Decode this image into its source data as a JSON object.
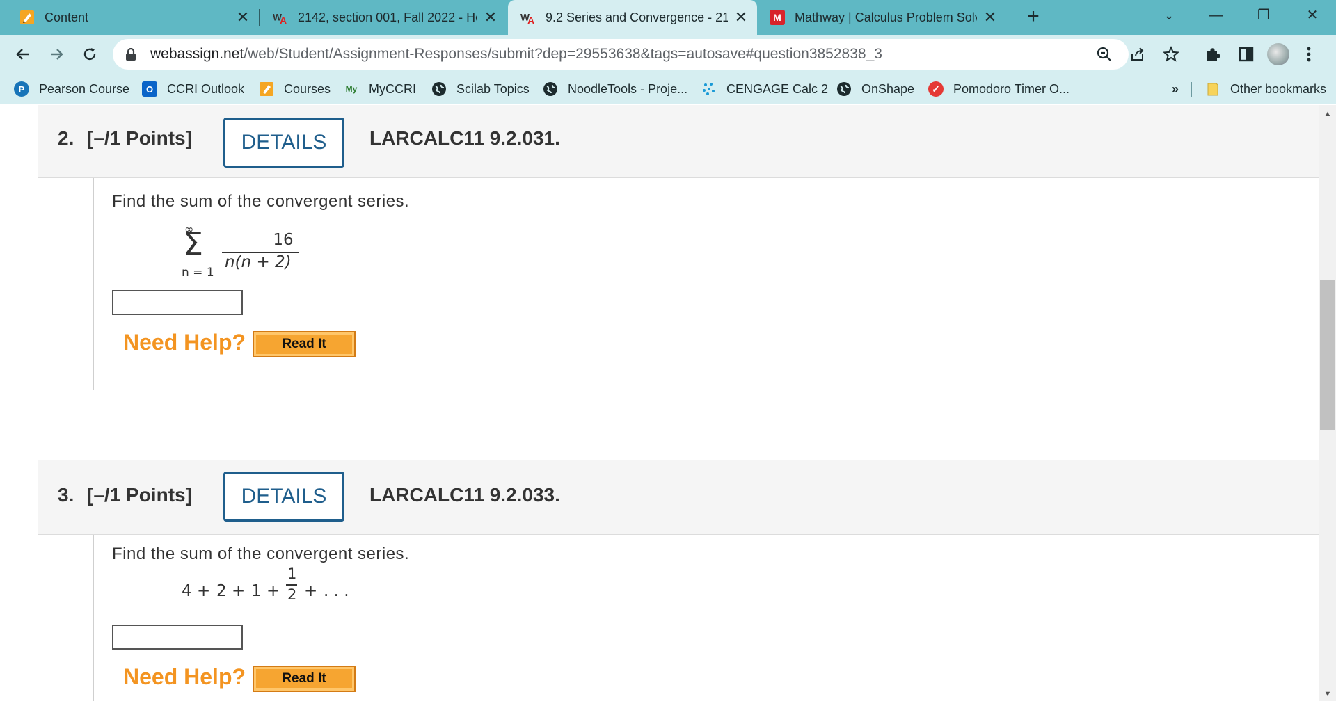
{
  "tabs": [
    {
      "label": "Content",
      "icon": "pencil-icon",
      "close": "✕"
    },
    {
      "label": "2142, section 001, Fall 2022 - Hom",
      "icon": "webassign-icon",
      "close": "✕"
    },
    {
      "label": "9.2 Series and Convergence - 2142",
      "icon": "webassign-icon",
      "close": "✕"
    },
    {
      "label": "Mathway | Calculus Problem Solver",
      "icon": "mathway-icon",
      "close": "✕"
    }
  ],
  "window": {
    "new_tab": "+",
    "minimize": "—",
    "restore": "❐",
    "close": "✕",
    "tab_search": "⌄"
  },
  "address": {
    "host": "webassign.net",
    "path": "/web/Student/Assignment-Responses/submit?dep=29553638&tags=autosave#question3852838_3"
  },
  "bookmarks": [
    {
      "label": "Pearson Course",
      "icon": "pearson-icon"
    },
    {
      "label": "CCRI Outlook",
      "icon": "outlook-icon"
    },
    {
      "label": "Courses",
      "icon": "pencil-icon"
    },
    {
      "label": "MyCCRI",
      "icon": "myccri-icon"
    },
    {
      "label": "Scilab Topics",
      "icon": "globe-icon"
    },
    {
      "label": "NoodleTools - Proje...",
      "icon": "globe-icon"
    },
    {
      "label": "CENGAGE Calc 2",
      "icon": "cengage-icon"
    },
    {
      "label": "OnShape",
      "icon": "globe-icon"
    },
    {
      "label": "Pomodoro Timer O...",
      "icon": "check-icon"
    }
  ],
  "bookmarks_overflow": "»",
  "other_bookmarks": "Other bookmarks",
  "questions": [
    {
      "number": "2.",
      "points": "[–/1 Points]",
      "details": "DETAILS",
      "code": "LARCALC11 9.2.031.",
      "prompt": "Find the sum of the convergent series.",
      "math": {
        "upper": "∞",
        "sigma": "Σ",
        "lower": "n = 1",
        "numerator": "16",
        "denominator": "n(n + 2)"
      },
      "need_help": "Need Help?",
      "read_it": "Read It"
    },
    {
      "number": "3.",
      "points": "[–/1 Points]",
      "details": "DETAILS",
      "code": "LARCALC11 9.2.033.",
      "prompt": "Find the sum of the convergent series.",
      "math": {
        "t1": "4",
        "t2": "2",
        "t3": "1",
        "frac_num": "1",
        "frac_den": "2",
        "plus": "+",
        "ellipsis": ". . ."
      },
      "need_help": "Need Help?",
      "read_it": "Read It"
    }
  ],
  "colors": {
    "tabstrip": "#5fb8c4",
    "toolbar": "#d6eef1",
    "details": "#1f5e8c",
    "need_help": "#f39421",
    "math_red": "#e01010"
  }
}
